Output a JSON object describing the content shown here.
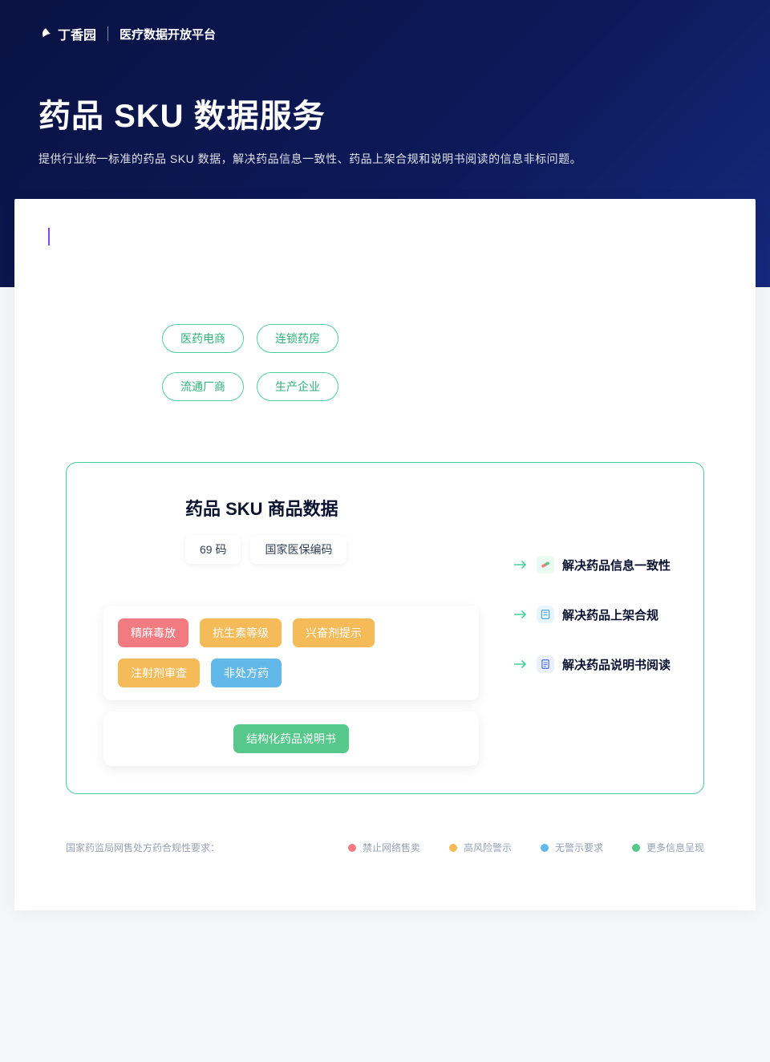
{
  "header": {
    "brand": "丁香园",
    "platform": "医疗数据开放平台"
  },
  "hero": {
    "title": "药品 SKU 数据服务",
    "subtitle": "提供行业统一标准的药品 SKU 数据，解决药品信息一致性、药品上架合规和说明书阅读的信息非标问题。"
  },
  "sources": {
    "row1": [
      "医药电商",
      "连锁药房"
    ],
    "row2": [
      "流通厂商",
      "生产企业"
    ]
  },
  "main_card": {
    "title": "药品 SKU 商品数据",
    "codes": [
      "69 码",
      "国家医保编码"
    ],
    "tags_row1": [
      {
        "label": "精麻毒放",
        "color": "red"
      },
      {
        "label": "抗生素等级",
        "color": "oran"
      },
      {
        "label": "兴奋剂提示",
        "color": "oran"
      }
    ],
    "tags_row2": [
      {
        "label": "注射剂审查",
        "color": "oran"
      },
      {
        "label": "非处方药",
        "color": "blue"
      }
    ],
    "struct_label": "结构化药品说明书",
    "outputs": [
      {
        "label": "解决药品信息一致性",
        "icon": "pill"
      },
      {
        "label": "解决药品上架合规",
        "icon": "form"
      },
      {
        "label": "解决药品说明书阅读",
        "icon": "doc"
      }
    ]
  },
  "legend": {
    "lead": "国家药监局网售处方药合规性要求：",
    "items": [
      {
        "label": "禁止网络售卖",
        "color": "red"
      },
      {
        "label": "高风险警示",
        "color": "orn"
      },
      {
        "label": "无警示要求",
        "color": "blu"
      },
      {
        "label": "更多信息呈现",
        "color": "grn"
      }
    ]
  }
}
